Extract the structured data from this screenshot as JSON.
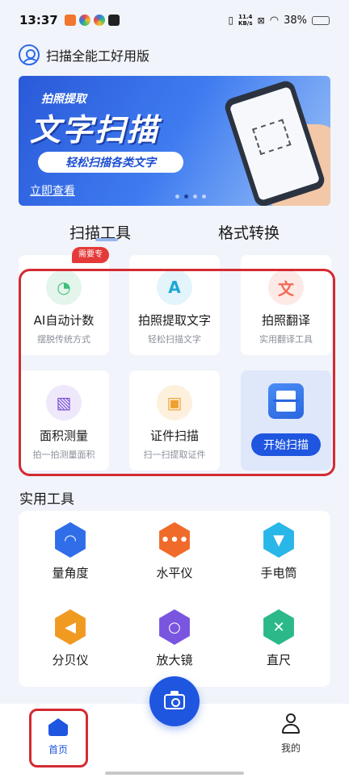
{
  "status_bar": {
    "time": "13:37",
    "speed_value": "11.4",
    "speed_unit": "KB/s",
    "battery": "38%",
    "battery_fraction": 0.38
  },
  "header": {
    "title": "扫描全能工好用版"
  },
  "banner": {
    "tag": "拍照提取",
    "title": "文字扫描",
    "subtitle": "轻松扫描各类文字",
    "link": "立即查看",
    "slide_count": 4,
    "active_slide": 2
  },
  "tabs": [
    {
      "label": "扫描工具"
    },
    {
      "label": "格式转换"
    }
  ],
  "tools": [
    {
      "title": "AI自动计数",
      "sub": "摆脱传统方式",
      "badge": "需要专业",
      "icon": "pie-chart-icon",
      "color": "#3ec07a",
      "bg": "#e4f6ec",
      "glyph": "◔"
    },
    {
      "title": "拍照提取文字",
      "sub": "轻松扫描文字",
      "icon": "letter-a-icon",
      "color": "#1ea7d8",
      "bg": "#e3f4fb",
      "glyph": "A"
    },
    {
      "title": "拍照翻译",
      "sub": "实用翻译工具",
      "icon": "translate-icon",
      "color": "#ef6b57",
      "bg": "#fde9e5",
      "glyph": "文"
    },
    {
      "title": "面积测量",
      "sub": "拍一拍测量面积",
      "icon": "area-measure-icon",
      "color": "#7a4fd6",
      "bg": "#efe8fb",
      "glyph": "▧"
    },
    {
      "title": "证件扫描",
      "sub": "扫一扫提取证件",
      "icon": "id-card-icon",
      "color": "#f0a030",
      "bg": "#fdf1de",
      "glyph": "▣"
    }
  ],
  "start_scan": {
    "label": "开始扫描",
    "icon": "document-scan-icon"
  },
  "utilities_title": "实用工具",
  "utilities": [
    {
      "label": "量角度",
      "icon": "protractor-icon",
      "color": "#2f6ee8",
      "glyph": "◠"
    },
    {
      "label": "水平仪",
      "icon": "level-icon",
      "color": "#f06a2a",
      "glyph": "•••"
    },
    {
      "label": "手电筒",
      "icon": "flashlight-icon",
      "color": "#29b6e8",
      "glyph": "▼"
    },
    {
      "label": "分贝仪",
      "icon": "speaker-icon",
      "color": "#f09a22",
      "glyph": "◀"
    },
    {
      "label": "放大镜",
      "icon": "magnifier-icon",
      "color": "#7a55e0",
      "glyph": "○"
    },
    {
      "label": "直尺",
      "icon": "ruler-icon",
      "color": "#2bb98a",
      "glyph": "✕"
    }
  ],
  "bottom_nav": {
    "home": "首页",
    "me": "我的"
  },
  "colors": {
    "accent": "#1f56e0",
    "highlight": "#d42a32"
  }
}
